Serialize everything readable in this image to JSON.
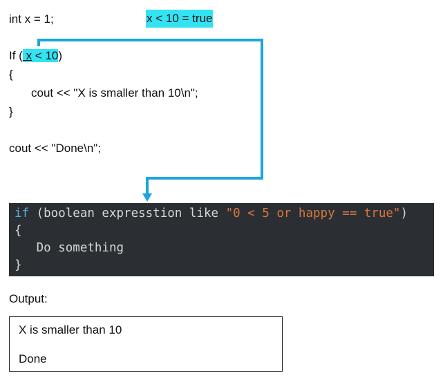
{
  "code_top": {
    "decl": "int x = 1;",
    "eval_note": "x < 10 = true",
    "if_keyword": "If (",
    "if_space": " ",
    "if_x": "x",
    "if_rest": " < 10",
    "if_close": ")",
    "open_brace": "{",
    "cout_line": "cout << \"X is smaller than 10\\n\";",
    "close_brace": "}",
    "done_line": "cout << \"Done\\n\";"
  },
  "code_panel": {
    "kw_if": "if",
    "open_paren": " (boolean expresstion like ",
    "str_part1": "\"0 ",
    "op_lt": "<",
    "str_part2": " 5 or happy ",
    "op_eq": "==",
    "str_part3": " true\"",
    "close_paren": ")",
    "open_brace": "{",
    "body": "   Do something",
    "close_brace": "}"
  },
  "output": {
    "label": "Output:",
    "line1": "X is smaller than 10",
    "line2": "Done"
  },
  "colors": {
    "highlight": "#33e3f2",
    "arrow": "#1ba6dd",
    "panel_bg": "#2b2f34",
    "keyword": "#5fa8d3",
    "string": "#d9753e"
  }
}
